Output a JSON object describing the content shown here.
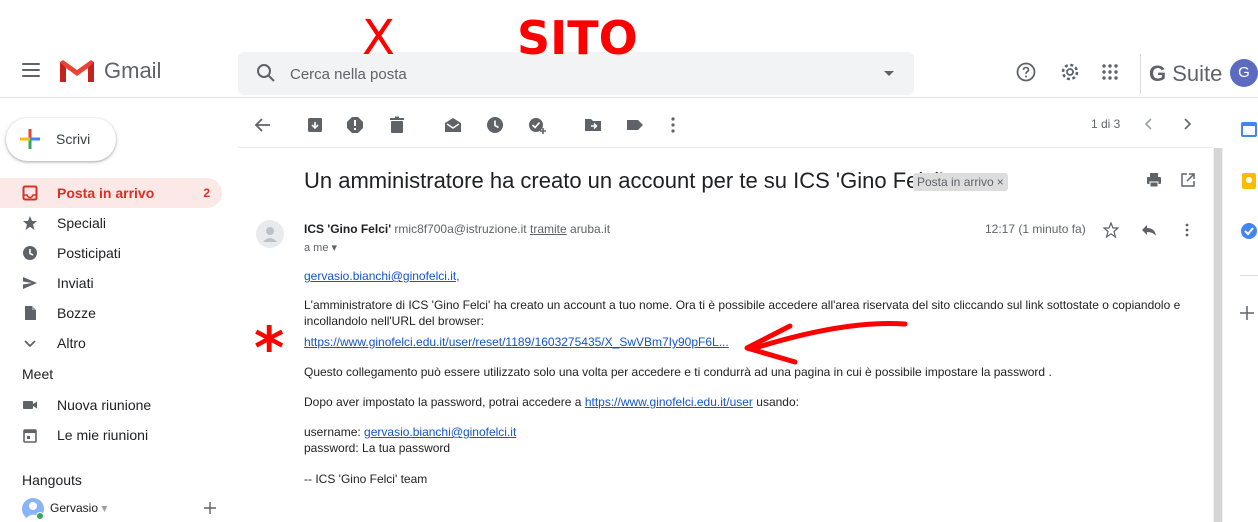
{
  "header": {
    "product_name": "Gmail",
    "search_placeholder": "Cerca nella posta",
    "gsuite_g": "G",
    "gsuite_suite": "Suite",
    "avatar_letter": "G"
  },
  "annotations": {
    "cross": "X",
    "site_word": "SITO",
    "asterisk": "*",
    "color": "#ff0000"
  },
  "sidebar": {
    "compose_label": "Scrivi",
    "items": [
      {
        "label": "Posta in arrivo",
        "count": "2",
        "icon": "inbox-icon"
      },
      {
        "label": "Speciali",
        "icon": "star-icon"
      },
      {
        "label": "Posticipati",
        "icon": "clock-icon"
      },
      {
        "label": "Inviati",
        "icon": "send-icon"
      },
      {
        "label": "Bozze",
        "icon": "draft-icon"
      },
      {
        "label": "Altro",
        "icon": "chevron-down-icon"
      }
    ],
    "meet_title": "Meet",
    "meet_items": [
      {
        "label": "Nuova riunione",
        "icon": "videocam-icon"
      },
      {
        "label": "Le mie riunioni",
        "icon": "calendar-icon"
      }
    ],
    "hangouts_title": "Hangouts",
    "hangouts_user": "Gervasio",
    "hangouts_user_caret": "▾"
  },
  "toolbar": {
    "pager": "1 di 3"
  },
  "message": {
    "subject": "Un amministratore ha creato un account per te su ICS 'Gino Felci'",
    "label_chip": "Posta in arrivo",
    "label_chip_close": "×",
    "sender_name": "ICS 'Gino Felci'",
    "sender_email": "rmic8f700a@istruzione.it",
    "via_word": "tramite",
    "via_domain": "aruba.it",
    "to": "a me",
    "time": "12:17 (1 minuto fa)",
    "greeting": "gervasio.bianchi@ginofelci.it,",
    "paragraph1": "L'amministratore di ICS 'Gino Felci' ha creato un account a tuo nome. Ora ti è possibile accedere all'area riservata del sito cliccando sul link sottostate o copiandolo e incollandolo nell'URL del browser:",
    "reset_link": "https://www.ginofelci.edu.it/user/reset/1189/1603275435/X_SwVBm7Iy90pF6L...",
    "paragraph2": "Questo collegamento può essere utilizzato solo una volta per accedere e ti condurrà ad una pagina in cui è possibile impostare la password .",
    "paragraph3_prefix": "Dopo aver impostato la password, potrai accedere a",
    "user_link": "https://www.ginofelci.edu.it/user",
    "paragraph3_suffix": "usando:",
    "username_label": "username:",
    "username_value": "gervasio.bianchi@ginofelci.it",
    "password_line": "password: La tua password",
    "signature": "-- ICS 'Gino Felci' team"
  },
  "colors": {
    "accent_red": "#d93025",
    "active_bg": "#fce8e6",
    "link": "#1155cc"
  }
}
